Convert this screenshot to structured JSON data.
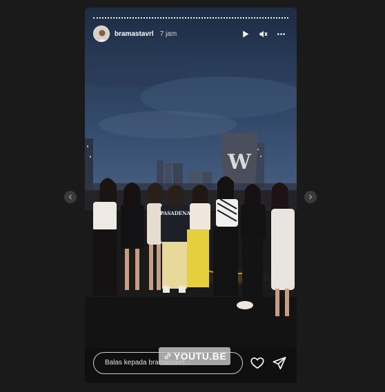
{
  "story": {
    "username": "bramastavrl",
    "timestamp": "7 jam",
    "avatar_icon": "user-avatar",
    "controls": {
      "play_icon": "play-icon",
      "mute_icon": "speaker-muted-icon",
      "more_icon": "more-horizontal-icon"
    },
    "photo_description_icon": "group-photo",
    "building_sign": "W",
    "sweatshirt_text": "PASADENA"
  },
  "footer": {
    "reply_placeholder": "Balas kepada bramastavrl...",
    "like_icon": "heart-icon",
    "share_icon": "send-icon"
  },
  "watermark": {
    "text": "YOUTU.BE",
    "icon": "link-icon"
  },
  "navigation": {
    "prev_icon": "chevron-left-icon",
    "next_icon": "chevron-right-icon"
  },
  "colors": {
    "page_background": "#1a1a1a",
    "sky": "#3c5478",
    "text_primary": "#ffffff"
  }
}
